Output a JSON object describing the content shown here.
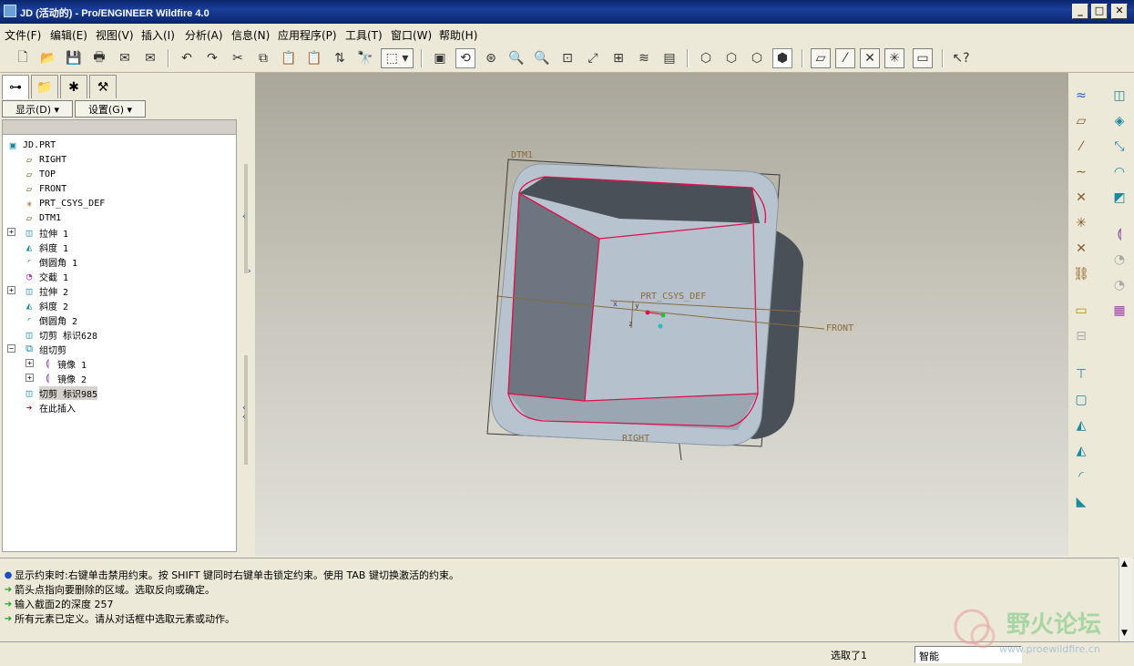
{
  "window": {
    "title": "JD (活动的) - Pro/ENGINEER Wildfire 4.0"
  },
  "menu": [
    "文件(F)",
    "编辑(E)",
    "视图(V)",
    "插入(I)",
    "分析(A)",
    "信息(N)",
    "应用程序(P)",
    "工具(T)",
    "窗口(W)",
    "帮助(H)"
  ],
  "left_panel": {
    "show_button": "显示(D) ▾",
    "settings_button": "设置(G) ▾",
    "tree": [
      {
        "label": "JD.PRT",
        "icon": "part-icon"
      },
      {
        "label": "RIGHT",
        "icon": "datum-plane-icon"
      },
      {
        "label": "TOP",
        "icon": "datum-plane-icon"
      },
      {
        "label": "FRONT",
        "icon": "datum-plane-icon"
      },
      {
        "label": "PRT_CSYS_DEF",
        "icon": "csys-icon"
      },
      {
        "label": "DTM1",
        "icon": "datum-plane-icon"
      },
      {
        "label": "拉伸 1",
        "icon": "extrude-icon"
      },
      {
        "label": "斜度 1",
        "icon": "draft-icon"
      },
      {
        "label": "倒圆角 1",
        "icon": "round-icon"
      },
      {
        "label": "交截 1",
        "icon": "intersect-icon"
      },
      {
        "label": "拉伸 2",
        "icon": "extrude-icon"
      },
      {
        "label": "斜度 2",
        "icon": "draft-icon"
      },
      {
        "label": "倒圆角 2",
        "icon": "round-icon"
      },
      {
        "label": "切剪 标识628",
        "icon": "cut-icon"
      },
      {
        "label": "组切剪",
        "icon": "group-icon"
      },
      {
        "label": "镜像 1",
        "icon": "mirror-icon"
      },
      {
        "label": "镜像 2",
        "icon": "mirror-icon"
      },
      {
        "label": "切剪 标识985",
        "icon": "cut-icon"
      },
      {
        "label": "在此插入",
        "icon": "insert-here-arrow-icon"
      }
    ]
  },
  "viewport": {
    "labels": {
      "dtm1": "DTM1",
      "csys": "PRT_CSYS_DEF",
      "front": "FRONT",
      "right": "RIGHT",
      "axis_x": "x",
      "axis_y": "y",
      "axis_z": "z"
    }
  },
  "messages": [
    {
      "icon": "info-dot-icon",
      "text": "显示约束时:右键单击禁用约束。按 SHIFT 键同时右键单击锁定约束。使用 TAB 键切换激活的约束。"
    },
    {
      "icon": "prompt-arrow-icon",
      "text": "箭头点指向要删除的区域。选取反向或确定。"
    },
    {
      "icon": "prompt-arrow-icon",
      "text": "输入截面2的深度  257"
    },
    {
      "icon": "prompt-arrow-icon",
      "text": "所有元素已定义。请从对话框中选取元素或动作。"
    }
  ],
  "status": {
    "selected": "选取了1",
    "filter": "智能"
  },
  "watermark": {
    "text": "野火论坛",
    "url": "www.proewildfire.cn"
  },
  "colors": {
    "title_bar": "#0a246a",
    "model_face": "#b7c4cf",
    "model_dark": "#4a5058",
    "edge_highlight": "#e0104a",
    "datum": "#8b6a3a"
  }
}
